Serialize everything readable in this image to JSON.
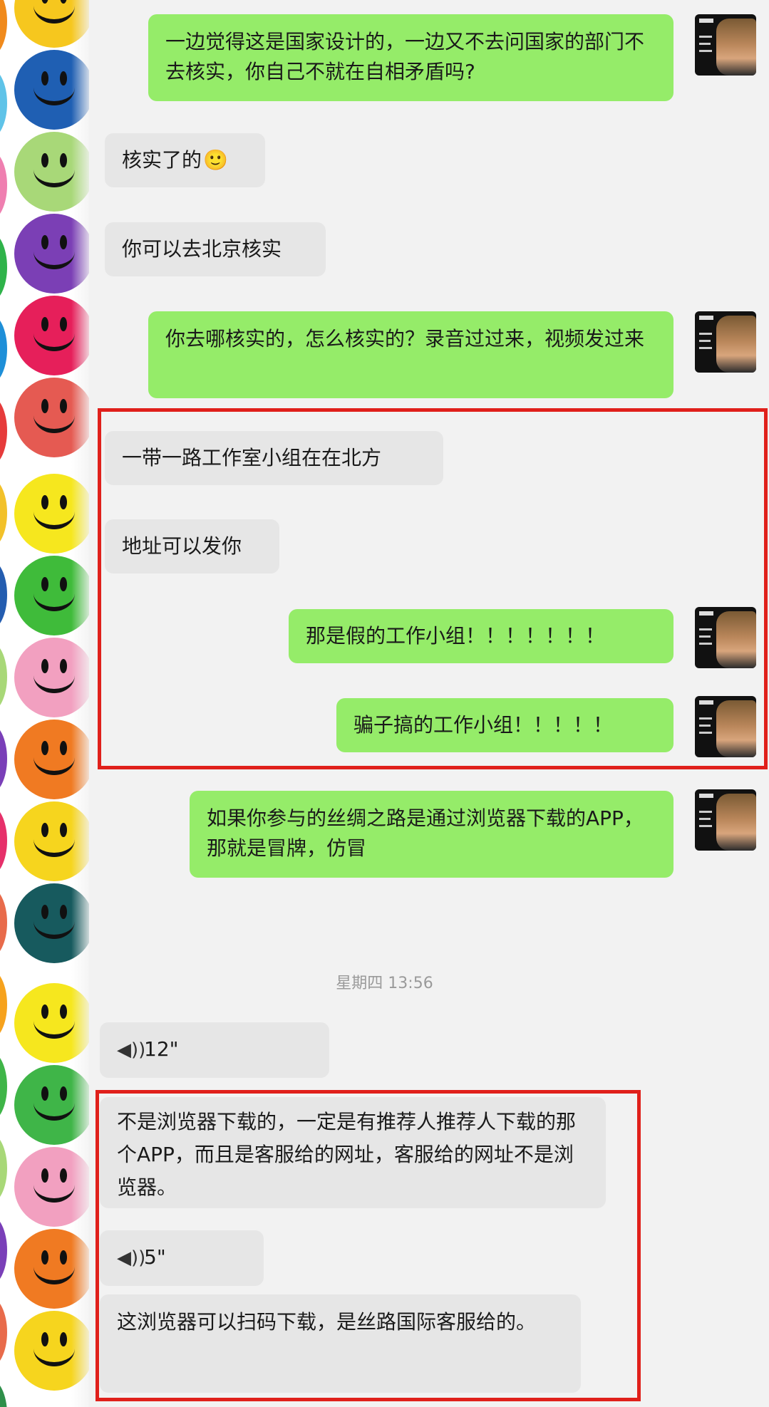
{
  "messages": {
    "m1": "一边觉得这是国家设计的，一边又不去问国家的部门不去核实，你自己不就在自相矛盾吗?",
    "m2": "核实了的",
    "m2_emoji": "🙂",
    "m3": "你可以去北京核实",
    "m4": "你去哪核实的，怎么核实的？录音过过来，视频发过来",
    "m5": "一带一路工作室小组在在北方",
    "m6": "地址可以发你",
    "m7": "那是假的工作小组！！！！！！！",
    "m8": "骗子搞的工作小组！！！！！",
    "m9": "如果你参与的丝绸之路是通过浏览器下载的APP，那就是冒牌，仿冒",
    "timestamp": "星期四 13:56",
    "voice1": "12\"",
    "m10": "不是浏览器下载的，一定是有推荐人推荐人下载的那个APP，而且是客服给的网址，客服给的网址不是浏览器。",
    "voice2": "5\"",
    "m11": "这浏览器可以扫码下载，是丝路国际客服给的。"
  },
  "icons": {
    "voice": "voice-message-icon",
    "smiley": "smiley-face-icon"
  },
  "colors": {
    "me_bubble": "#95ec69",
    "them_bubble": "#e6e6e6",
    "highlight": "#e0201b"
  }
}
